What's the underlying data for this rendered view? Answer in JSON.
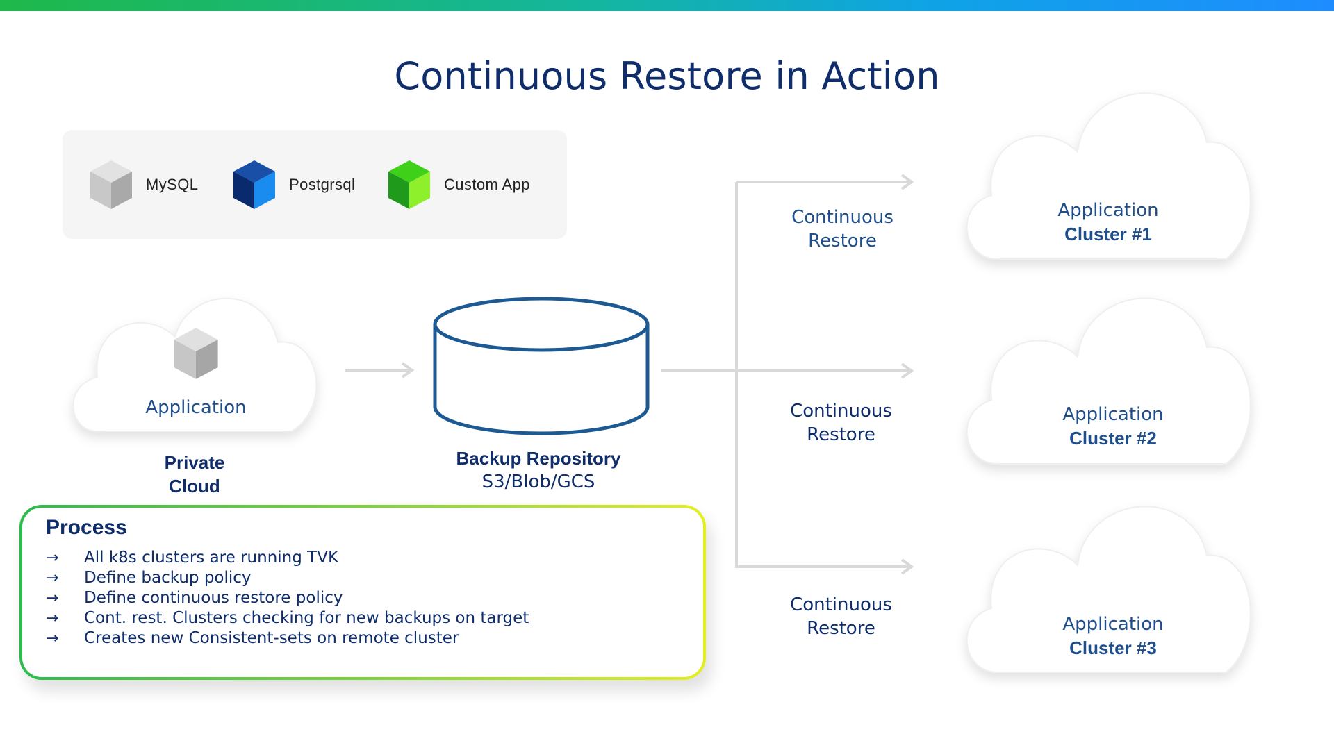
{
  "title": "Continuous Restore in Action",
  "legend": {
    "items": [
      {
        "label": "MySQL",
        "icon": "gray-cube-icon",
        "color": "#bdbdbd"
      },
      {
        "label": "Postgrsql",
        "icon": "blue-cube-icon",
        "color": "#0a56c8"
      },
      {
        "label": "Custom App",
        "icon": "green-cube-icon",
        "color": "#35c21a"
      }
    ]
  },
  "source": {
    "cloud_label": "Application",
    "name_line1": "Private",
    "name_line2": "Cloud"
  },
  "repository": {
    "name": "Backup Repository",
    "subtitle": "S3/Blob/GCS"
  },
  "restore_labels": [
    {
      "line1": "Continuous",
      "line2": "Restore"
    },
    {
      "line1": "Continuous",
      "line2": "Restore"
    },
    {
      "line1": "Continuous",
      "line2": "Restore"
    }
  ],
  "clusters": [
    {
      "line1": "Application",
      "line2": "Cluster #1"
    },
    {
      "line1": "Application",
      "line2": "Cluster #2"
    },
    {
      "line1": "Application",
      "line2": "Cluster #3"
    }
  ],
  "process": {
    "title": "Process",
    "steps": [
      "All k8s clusters are running TVK",
      "Define backup policy",
      "Define continuous restore policy",
      "Cont. rest. Clusters checking for new backups on target",
      "Creates new Consistent-sets on remote cluster"
    ]
  },
  "colors": {
    "accent_dark_blue": "#0f2d6b",
    "accent_blue": "#1e4e8c",
    "repository_stroke": "#1d5a93",
    "arrow_gray": "#d9d9d9"
  }
}
